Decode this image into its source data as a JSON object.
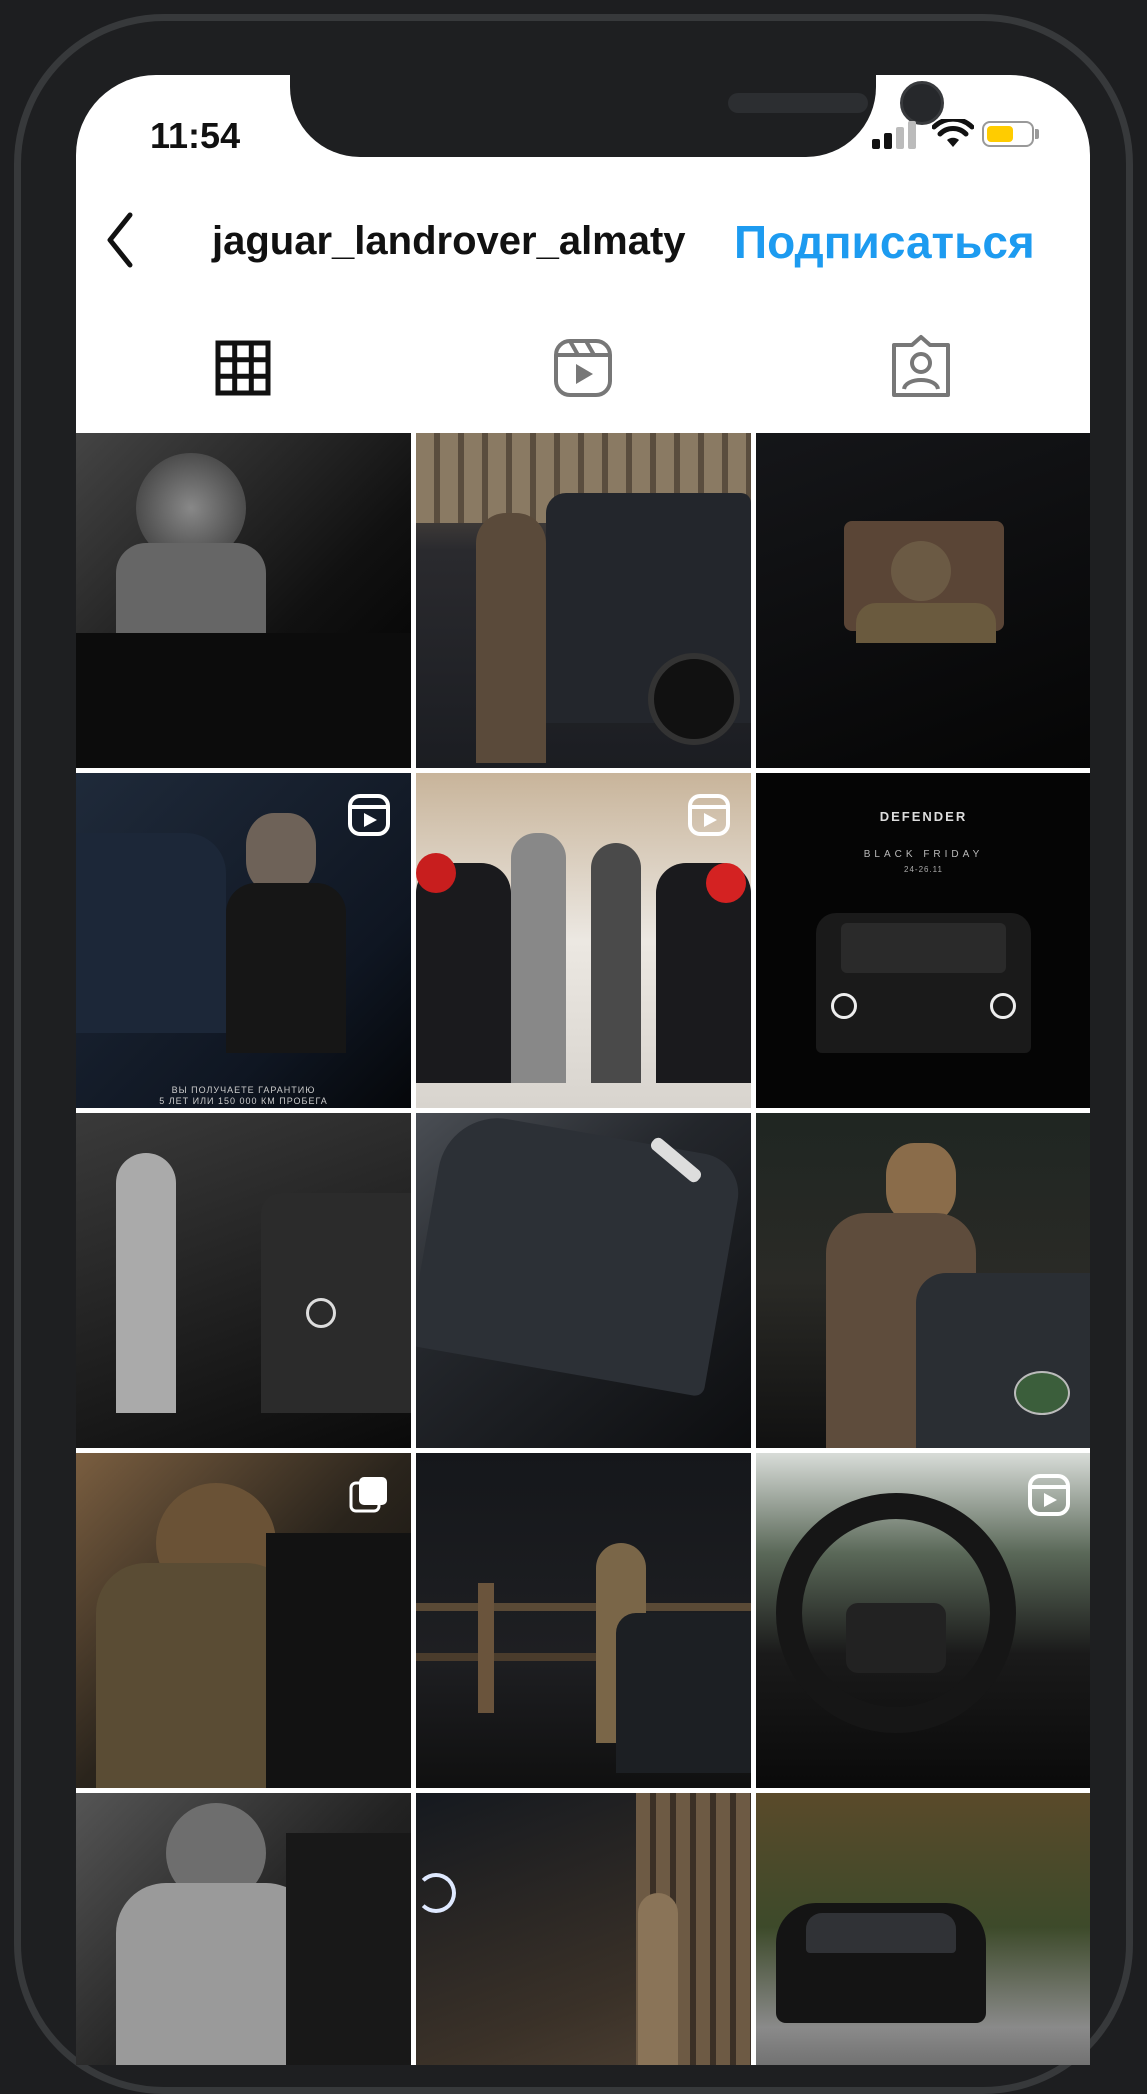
{
  "status_bar": {
    "time": "11:54"
  },
  "header": {
    "username": "jaguar_landrover_almaty",
    "follow_label": "Подписаться"
  },
  "tabs": [
    {
      "icon": "grid-icon"
    },
    {
      "icon": "reels-icon"
    },
    {
      "icon": "tagged-icon"
    }
  ],
  "posts": [
    {
      "type": "photo",
      "scene": "black-and-white woman in leopard headscarf driving"
    },
    {
      "type": "photo",
      "scene": "person standing beside dark Defender near wooden building"
    },
    {
      "type": "photo",
      "scene": "woman seen through car window at night"
    },
    {
      "type": "reel",
      "scene": "man opening door of dark Defender",
      "caption": "ВЫ ПОЛУЧАЕТЕ ГАРАНТИЮ\n5 ЛЕТ ИЛИ 150 000 КМ ПРОБЕГА"
    },
    {
      "type": "reel",
      "scene": "couple between two covered cars with red bows"
    },
    {
      "type": "photo",
      "scene": "Defender Black Friday promo",
      "promo_title": "DEFENDER",
      "promo_text": "BLACK FRIDAY",
      "promo_date": "24-26.11"
    },
    {
      "type": "photo",
      "scene": "woman walking toward Defender, black and white"
    },
    {
      "type": "photo",
      "scene": "close-up of dark Defender hood"
    },
    {
      "type": "photo",
      "scene": "woman leaning on Range Rover hood"
    },
    {
      "type": "carousel",
      "scene": "woman in leopard headscarf and sunglasses"
    },
    {
      "type": "photo",
      "scene": "woman walking by fence at night with Defender"
    },
    {
      "type": "reel",
      "scene": "steering wheel interior view"
    },
    {
      "type": "photo",
      "scene": "woman at car door, black and white"
    },
    {
      "type": "photo",
      "scene": "woman walking by headlights at dusk"
    },
    {
      "type": "photo",
      "scene": "Range Rover on mountain road in autumn"
    }
  ]
}
